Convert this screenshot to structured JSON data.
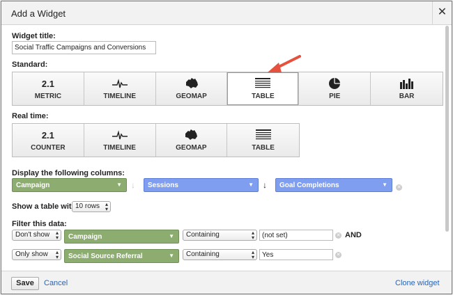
{
  "dialog": {
    "title": "Add a Widget",
    "close_glyph": "✕"
  },
  "widget_title": {
    "label": "Widget title:",
    "value": "Social Traffic Campaigns and Conversions"
  },
  "standard": {
    "label": "Standard:",
    "tiles": [
      {
        "icon": "metric-icon",
        "icon_text": "2.1",
        "label": "METRIC"
      },
      {
        "icon": "timeline-icon",
        "label": "TIMELINE"
      },
      {
        "icon": "geomap-icon",
        "label": "GEOMAP"
      },
      {
        "icon": "table-icon",
        "label": "TABLE",
        "selected": true
      },
      {
        "icon": "pie-icon",
        "label": "PIE"
      },
      {
        "icon": "bar-icon",
        "label": "BAR"
      }
    ]
  },
  "realtime": {
    "label": "Real time:",
    "tiles": [
      {
        "icon": "counter-icon",
        "icon_text": "2.1",
        "label": "COUNTER"
      },
      {
        "icon": "timeline-icon",
        "label": "TIMELINE"
      },
      {
        "icon": "geomap-icon",
        "label": "GEOMAP"
      },
      {
        "icon": "table-icon",
        "label": "TABLE"
      }
    ]
  },
  "columns": {
    "label": "Display the following columns:",
    "items": [
      "Campaign",
      "Sessions",
      "Goal Completions"
    ]
  },
  "rows": {
    "label": "Show a table with",
    "value": "10 rows"
  },
  "filter": {
    "label": "Filter this data:",
    "rows": [
      {
        "mode": "Don't show",
        "dimension": "Campaign",
        "match": "Containing",
        "value": "(not set)",
        "conjunction": "AND"
      },
      {
        "mode": "Only show",
        "dimension": "Social Source Referral",
        "match": "Containing",
        "value": "Yes"
      }
    ]
  },
  "footer": {
    "save": "Save",
    "cancel": "Cancel",
    "clone": "Clone widget"
  },
  "colors": {
    "dimension_green": "#8cad6f",
    "metric_blue": "#7f9ef0",
    "link_blue": "#2a63b5",
    "annotation_red": "#e8503e"
  }
}
